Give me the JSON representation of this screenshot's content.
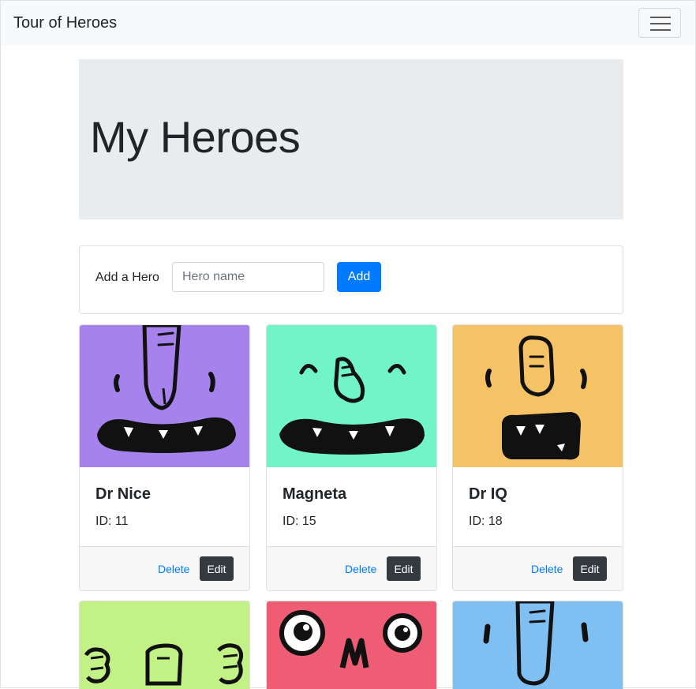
{
  "navbar": {
    "brand": "Tour of Heroes",
    "menu_icon": "hamburger-icon"
  },
  "page_title": "My Heroes",
  "add_hero": {
    "label": "Add a Hero",
    "placeholder": "Hero name",
    "button": "Add"
  },
  "heroes": [
    {
      "name": "Dr Nice",
      "id": "ID: 11",
      "color": "#a682ec",
      "delete": "Delete",
      "edit": "Edit"
    },
    {
      "name": "Magneta",
      "id": "ID: 15",
      "color": "#71f5c8",
      "delete": "Delete",
      "edit": "Edit"
    },
    {
      "name": "Dr IQ",
      "id": "ID: 18",
      "color": "#f6c266",
      "delete": "Delete",
      "edit": "Edit"
    }
  ],
  "more_heroes": [
    {
      "color": "#c2f186"
    },
    {
      "color": "#ee5d73"
    },
    {
      "color": "#80bff2"
    }
  ],
  "colors": {
    "primary": "#007bff",
    "dark": "#343a40",
    "jumbotron": "#e9ecef",
    "navbar": "#f8f9fa"
  }
}
